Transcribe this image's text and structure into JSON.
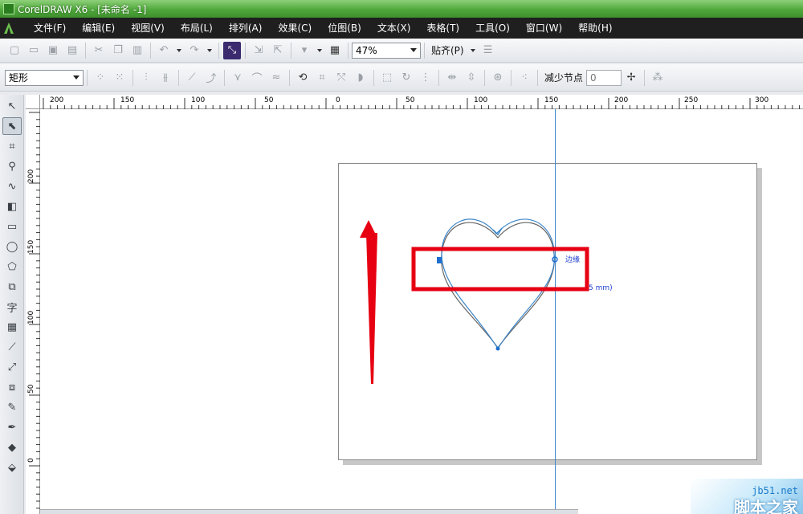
{
  "window": {
    "title": "CorelDRAW X6 - [未命名 -1]"
  },
  "menu": {
    "items": [
      "文件(F)",
      "编辑(E)",
      "视图(V)",
      "布局(L)",
      "排列(A)",
      "效果(C)",
      "位图(B)",
      "文本(X)",
      "表格(T)",
      "工具(O)",
      "窗口(W)",
      "帮助(H)"
    ]
  },
  "toolbar1": {
    "zoom_value": "47%",
    "snap_label": "贴齐(P)"
  },
  "toolbar2": {
    "object_type_value": "矩形",
    "reduce_nodes_label": "减少节点",
    "reduce_nodes_value": "0"
  },
  "ruler": {
    "top_labels": [
      "200",
      "150",
      "100",
      "50",
      "0",
      "50",
      "100",
      "150",
      "200",
      "250",
      "300"
    ],
    "left_labels": [
      "200",
      "150",
      "100",
      "50",
      "0"
    ]
  },
  "canvas": {
    "snap_hint_label": "边缘",
    "measure_hint": "5 mm)"
  },
  "watermark": {
    "site": "jb51.net",
    "brand": "脚本之家"
  },
  "colors": {
    "title_green": "#4fa83b",
    "menu_dark": "#1f1f1f",
    "guide_blue": "#3c86c8",
    "highlight_red": "#e60012"
  }
}
